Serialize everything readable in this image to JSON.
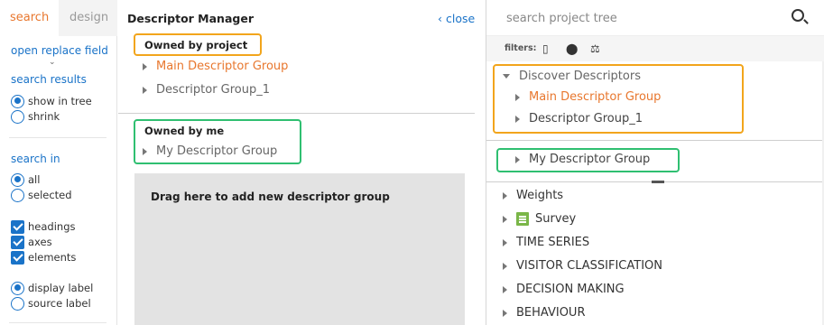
{
  "left": {
    "tabs": {
      "search": "search",
      "design": "design"
    },
    "open_replace_field": "open replace field",
    "search_results": {
      "heading": "search results",
      "options": [
        "show in tree",
        "shrink"
      ],
      "selected": "show in tree"
    },
    "search_in": {
      "heading": "search in",
      "options": [
        "all",
        "selected"
      ],
      "selected": "all"
    },
    "checks": [
      "headings",
      "axes",
      "elements"
    ],
    "label_options": [
      "display label",
      "source label"
    ],
    "label_selected": "display label"
  },
  "middle": {
    "title": "Descriptor Manager",
    "close": "close",
    "owned_by_project": {
      "heading": "Owned by project",
      "items": [
        "Main Descriptor Group",
        "Descriptor Group_1"
      ]
    },
    "owned_by_me": {
      "heading": "Owned by me",
      "items": [
        "My Descriptor Group"
      ]
    },
    "dropzone": "Drag here to add new descriptor group"
  },
  "right": {
    "search_placeholder": "search project tree",
    "filters_label": "filters:",
    "discover": {
      "label": "Discover Descriptors",
      "items": [
        "Main Descriptor Group",
        "Descriptor Group_1"
      ]
    },
    "my_group": "My Descriptor Group",
    "tree": [
      "Weights",
      "Survey",
      "TIME SERIES",
      "VISITOR CLASSIFICATION",
      "DECISION MAKING",
      "BEHAVIOUR"
    ]
  },
  "colors": {
    "accent": "#1a73c8",
    "orange": "#e8772e",
    "highlight_orange": "#f2a51c",
    "highlight_green": "#2fbf71"
  }
}
